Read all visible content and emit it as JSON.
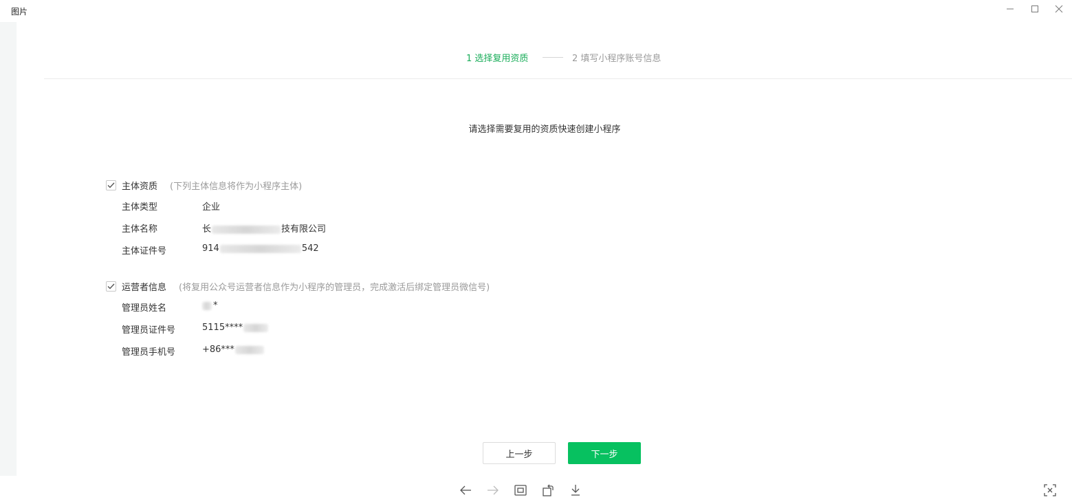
{
  "window": {
    "title": "图片"
  },
  "steps": {
    "step1": "1 选择复用资质",
    "step2": "2 填写小程序账号信息",
    "active_color": "#1aad5a",
    "inactive_color": "#9a9a9a"
  },
  "intro": "请选择需要复用的资质快速创建小程序",
  "entity_section": {
    "checked": true,
    "title": "主体资质",
    "note": "(下列主体信息将作为小程序主体)",
    "rows": [
      {
        "label": "主体类型",
        "value_prefix": "企业",
        "value_suffix": ""
      },
      {
        "label": "主体名称",
        "value_prefix": "长",
        "value_suffix": "技有限公司"
      },
      {
        "label": "主体证件号",
        "value_prefix": "914",
        "value_suffix": "542"
      }
    ]
  },
  "operator_section": {
    "checked": true,
    "title": "运营者信息",
    "note": "(将复用公众号运营者信息作为小程序的管理员，完成激活后绑定管理员微信号)",
    "rows": [
      {
        "label": "管理员姓名",
        "value_prefix": "",
        "value_suffix": "*"
      },
      {
        "label": "管理员证件号",
        "value_prefix": "5115****",
        "value_suffix": ""
      },
      {
        "label": "管理员手机号",
        "value_prefix": "+86***",
        "value_suffix": ""
      }
    ]
  },
  "buttons": {
    "prev": "上一步",
    "next": "下一步",
    "next_color": "#07c160"
  },
  "toolbar": {
    "icons": [
      "arrow-left-icon",
      "arrow-right-icon",
      "fit-screen-icon",
      "rotate-icon",
      "download-icon",
      "fullscreen-icon"
    ]
  }
}
